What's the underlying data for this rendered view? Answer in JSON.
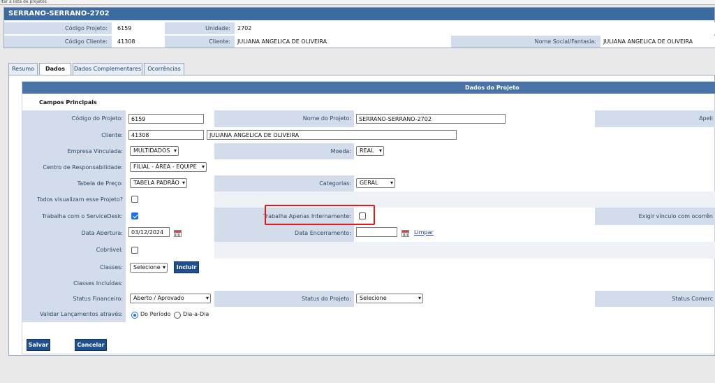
{
  "topbar": {
    "text": "ltar à lista de projetos"
  },
  "header": {
    "title": "SERRANO-SERRANO-2702",
    "codigo_projeto_label": "Código Projeto:",
    "codigo_projeto": "6159",
    "unidade_label": "Unidade:",
    "unidade": "2702",
    "codigo_cliente_label": "Código Cliente:",
    "codigo_cliente": "41308",
    "cliente_label": "Cliente:",
    "cliente": "JULIANA ANGELICA DE OLIVEIRA",
    "nome_social_label": "Nome Social/Fantasia:",
    "nome_social": "JULIANA ANGELICA DE OLIVEIRA"
  },
  "tabs": [
    "Resumo",
    "Dados",
    "Dados Complementares",
    "Ocorrências"
  ],
  "section": {
    "bar": "Dados do Projeto",
    "title": "Campos Principais"
  },
  "form": {
    "codigo_projeto_label": "Código do Projeto:",
    "codigo_projeto": "6159",
    "nome_projeto_label": "Nome do Projeto:",
    "nome_projeto": "SERRANO-SERRANO-2702",
    "apelido_label": "Apeli",
    "cliente_label": "Cliente:",
    "cliente_codigo": "41308",
    "cliente_nome": "JULIANA ANGELICA DE OLIVEIRA",
    "empresa_label": "Empresa Vinculada:",
    "empresa": "MULTIDADOS",
    "moeda_label": "Moeda:",
    "moeda": "REAL",
    "centro_label": "Centro de Responsabilidade:",
    "centro": "FILIAL - ÁREA - EQUIPE",
    "tabela_label": "Tabela de Preço:",
    "tabela": "TABELA PADRÃO",
    "categorias_label": "Categorias:",
    "categorias": "GERAL",
    "todos_label": "Todos visualizam esse Projeto?",
    "servicedesk_label": "Trabalha com o ServiceDesk:",
    "internamente_label": "Trabalha Apenas Internamente:",
    "exigir_label": "Exigir vínculo com ocorrên",
    "abertura_label": "Data Abertura:",
    "abertura": "03/12/2024",
    "encerramento_label": "Data Encerramento:",
    "limpar": "Limpar",
    "cobravel_label": "Cobrável:",
    "classes_label": "Classes:",
    "classes": "Selecione",
    "incluir": "Incluir",
    "classes_incluidas_label": "Classes Incluídas:",
    "status_fin_label": "Status Financeiro:",
    "status_fin": "Aberto / Aprovado",
    "status_proj_label": "Status do Projeto:",
    "status_proj": "Selecione",
    "status_com_label": "Status Comerc",
    "validar_label": "Validar Lançamentos através:",
    "periodo": "Do Período",
    "diadia": "Dia-a-Dia"
  },
  "buttons": {
    "salvar": "Salvar",
    "cancelar": "Cancelar"
  }
}
